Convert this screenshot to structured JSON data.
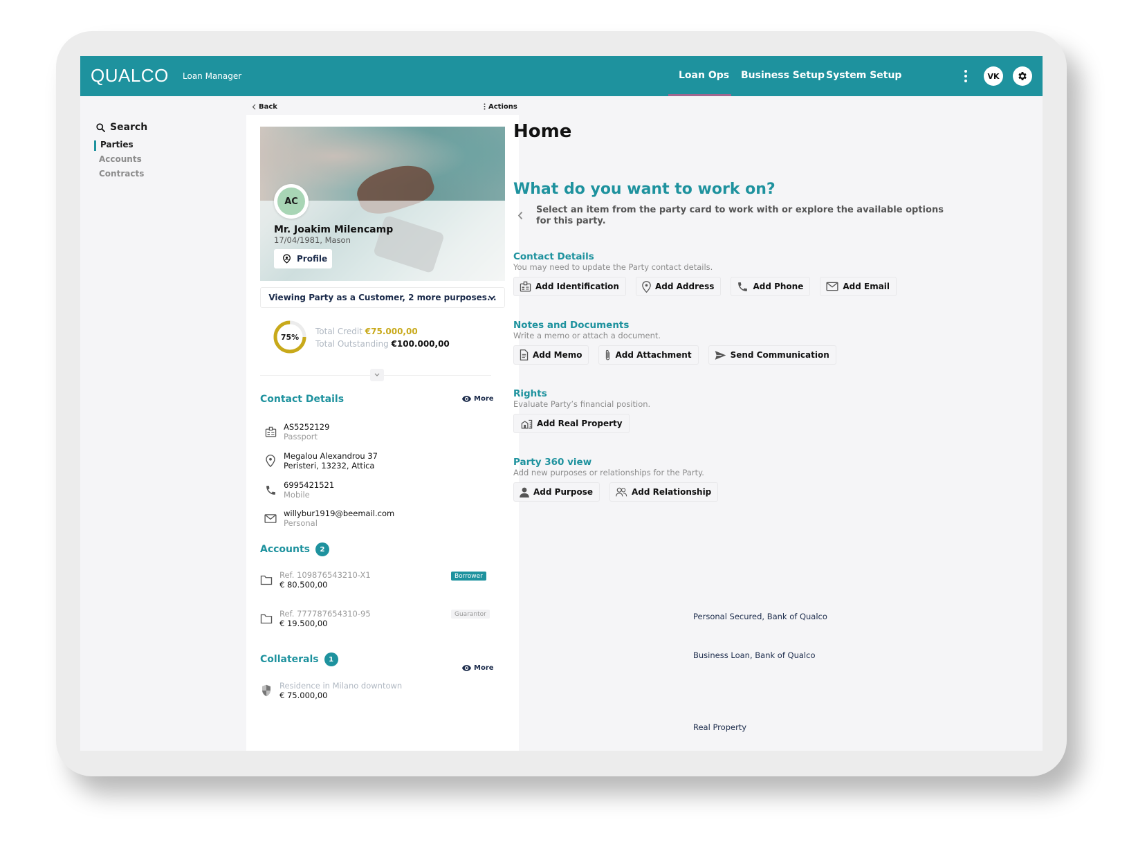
{
  "header": {
    "logo": "QUALCO",
    "app_name": "Loan Manager",
    "nav": [
      {
        "label": "Loan Ops",
        "active": true
      },
      {
        "label": "Business Setup",
        "active": false
      },
      {
        "label": "System Setup",
        "active": false
      }
    ],
    "user_initials": "VK",
    "accent_color": "#1e929e",
    "active_underline_color": "#a0678f"
  },
  "sidebar": {
    "search_label": "Search",
    "items": [
      {
        "label": "Parties",
        "active": true
      },
      {
        "label": "Accounts",
        "active": false
      },
      {
        "label": "Contracts",
        "active": false
      }
    ]
  },
  "party_card": {
    "back_label": "Back",
    "actions_label": "Actions",
    "initials": "AC",
    "name": "Mr. Joakim Milencamp",
    "subtitle": "17/04/1981, Mason",
    "profile_label": "Profile",
    "purpose_select": "Viewing Party as a Customer, 2 more purposes...",
    "credit": {
      "percent_label": "75%",
      "percent_value": 75,
      "total_credit_label": "Total Credit",
      "total_credit_value": "€75.000,00",
      "total_outstanding_label": "Total Outstanding",
      "total_outstanding_value": "€100.000,00",
      "ring_color": "#c8a91a"
    },
    "contact_details": {
      "title": "Contact Details",
      "more_label": "More",
      "items": [
        {
          "icon": "id-card-icon",
          "main": "AS5252129",
          "sub": "Passport"
        },
        {
          "icon": "location-pin-icon",
          "main": "Megalou Alexandrou 37",
          "sub": "Peristeri, 13232, Attica",
          "sub_dark": true
        },
        {
          "icon": "phone-icon",
          "main": "6995421521",
          "sub": "Mobile"
        },
        {
          "icon": "mail-icon",
          "main": "willybur1919@beemail.com",
          "sub": "Personal"
        }
      ]
    },
    "accounts": {
      "title": "Accounts",
      "count": "2",
      "items": [
        {
          "name": "Personal Secured, Bank of Qualco",
          "ref": "Ref. 109876543210-X1",
          "amount": "€ 80.500,00",
          "role": "Borrower"
        },
        {
          "name": "Business Loan, Bank of Qualco",
          "ref": "Ref. 777787654310-95",
          "amount": "€ 19.500,00",
          "role": "Guarantor"
        }
      ]
    },
    "collaterals": {
      "title": "Collaterals",
      "count": "1",
      "more_label": "More",
      "items": [
        {
          "name": "Real Property",
          "desc": "Residence in Milano downtown",
          "amount": "€ 75.000,00"
        }
      ]
    }
  },
  "main": {
    "title": "Home",
    "question": "What do you want to work on?",
    "description": "Select an item from the party card to work with or explore the available options for this party.",
    "groups": [
      {
        "title": "Contact Details",
        "subtitle": "You may need to update the Party contact details.",
        "buttons": [
          {
            "label": "Add Identification",
            "icon": "id-card-icon"
          },
          {
            "label": "Add Address",
            "icon": "location-pin-icon"
          },
          {
            "label": "Add Phone",
            "icon": "phone-icon"
          },
          {
            "label": "Add Email",
            "icon": "mail-icon"
          }
        ]
      },
      {
        "title": "Notes and Documents",
        "subtitle": "Write a memo or attach a document.",
        "buttons": [
          {
            "label": "Add Memo",
            "icon": "memo-icon"
          },
          {
            "label": "Add Attachment",
            "icon": "paperclip-icon"
          },
          {
            "label": "Send Communication",
            "icon": "send-icon"
          }
        ]
      },
      {
        "title": "Rights",
        "subtitle": "Evaluate Party’s financial position.",
        "buttons": [
          {
            "label": "Add Real Property",
            "icon": "building-icon"
          }
        ]
      },
      {
        "title": "Party 360 view",
        "subtitle": "Add new purposes or relationships for the Party.",
        "buttons": [
          {
            "label": "Add Purpose",
            "icon": "person-icon"
          },
          {
            "label": "Add Relationship",
            "icon": "people-icon"
          }
        ]
      }
    ]
  }
}
